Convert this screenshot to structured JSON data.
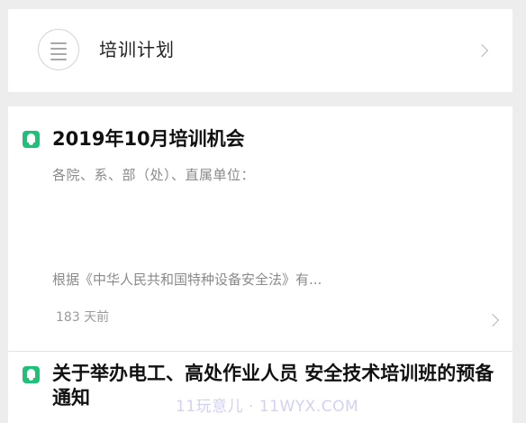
{
  "plan": {
    "label": "培训计划",
    "icon": "list-icon"
  },
  "notices": [
    {
      "title": "2019年10月培训机会",
      "subtitle": "各院、系、部（处）、直属单位：",
      "excerpt": "根据《中华人民共和国特种设备安全法》有...",
      "time": "183 天前",
      "icon": "bell-icon"
    },
    {
      "title": "关于举办电工、高处作业人员 安全技术培训班的预备通知",
      "icon": "bell-icon"
    }
  ],
  "watermark": "11玩意儿 · 11WYX.COM",
  "colors": {
    "accent": "#1fc07a",
    "background": "#ededed",
    "card": "#ffffff",
    "muted_text": "#8a8a8a",
    "watermark": "#c9c9f3"
  }
}
